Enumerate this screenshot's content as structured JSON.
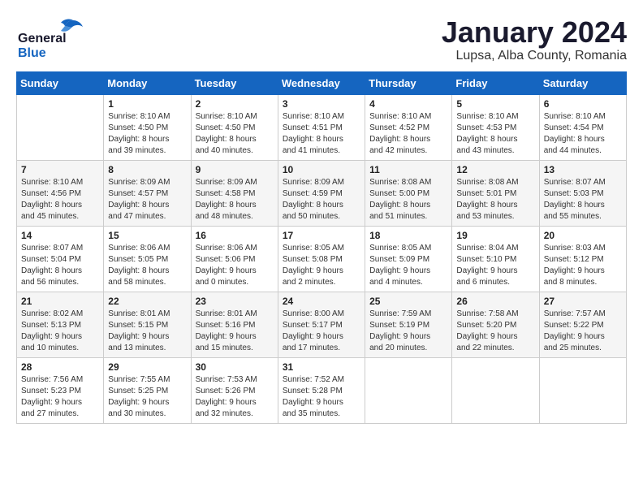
{
  "header": {
    "logo_line1": "General",
    "logo_line2": "Blue",
    "month_title": "January 2024",
    "location": "Lupsa, Alba County, Romania"
  },
  "days_of_week": [
    "Sunday",
    "Monday",
    "Tuesday",
    "Wednesday",
    "Thursday",
    "Friday",
    "Saturday"
  ],
  "weeks": [
    [
      {
        "day": "",
        "sunrise": "",
        "sunset": "",
        "daylight": ""
      },
      {
        "day": "1",
        "sunrise": "Sunrise: 8:10 AM",
        "sunset": "Sunset: 4:50 PM",
        "daylight": "Daylight: 8 hours and 39 minutes."
      },
      {
        "day": "2",
        "sunrise": "Sunrise: 8:10 AM",
        "sunset": "Sunset: 4:50 PM",
        "daylight": "Daylight: 8 hours and 40 minutes."
      },
      {
        "day": "3",
        "sunrise": "Sunrise: 8:10 AM",
        "sunset": "Sunset: 4:51 PM",
        "daylight": "Daylight: 8 hours and 41 minutes."
      },
      {
        "day": "4",
        "sunrise": "Sunrise: 8:10 AM",
        "sunset": "Sunset: 4:52 PM",
        "daylight": "Daylight: 8 hours and 42 minutes."
      },
      {
        "day": "5",
        "sunrise": "Sunrise: 8:10 AM",
        "sunset": "Sunset: 4:53 PM",
        "daylight": "Daylight: 8 hours and 43 minutes."
      },
      {
        "day": "6",
        "sunrise": "Sunrise: 8:10 AM",
        "sunset": "Sunset: 4:54 PM",
        "daylight": "Daylight: 8 hours and 44 minutes."
      }
    ],
    [
      {
        "day": "7",
        "sunrise": "Sunrise: 8:10 AM",
        "sunset": "Sunset: 4:56 PM",
        "daylight": "Daylight: 8 hours and 45 minutes."
      },
      {
        "day": "8",
        "sunrise": "Sunrise: 8:09 AM",
        "sunset": "Sunset: 4:57 PM",
        "daylight": "Daylight: 8 hours and 47 minutes."
      },
      {
        "day": "9",
        "sunrise": "Sunrise: 8:09 AM",
        "sunset": "Sunset: 4:58 PM",
        "daylight": "Daylight: 8 hours and 48 minutes."
      },
      {
        "day": "10",
        "sunrise": "Sunrise: 8:09 AM",
        "sunset": "Sunset: 4:59 PM",
        "daylight": "Daylight: 8 hours and 50 minutes."
      },
      {
        "day": "11",
        "sunrise": "Sunrise: 8:08 AM",
        "sunset": "Sunset: 5:00 PM",
        "daylight": "Daylight: 8 hours and 51 minutes."
      },
      {
        "day": "12",
        "sunrise": "Sunrise: 8:08 AM",
        "sunset": "Sunset: 5:01 PM",
        "daylight": "Daylight: 8 hours and 53 minutes."
      },
      {
        "day": "13",
        "sunrise": "Sunrise: 8:07 AM",
        "sunset": "Sunset: 5:03 PM",
        "daylight": "Daylight: 8 hours and 55 minutes."
      }
    ],
    [
      {
        "day": "14",
        "sunrise": "Sunrise: 8:07 AM",
        "sunset": "Sunset: 5:04 PM",
        "daylight": "Daylight: 8 hours and 56 minutes."
      },
      {
        "day": "15",
        "sunrise": "Sunrise: 8:06 AM",
        "sunset": "Sunset: 5:05 PM",
        "daylight": "Daylight: 8 hours and 58 minutes."
      },
      {
        "day": "16",
        "sunrise": "Sunrise: 8:06 AM",
        "sunset": "Sunset: 5:06 PM",
        "daylight": "Daylight: 9 hours and 0 minutes."
      },
      {
        "day": "17",
        "sunrise": "Sunrise: 8:05 AM",
        "sunset": "Sunset: 5:08 PM",
        "daylight": "Daylight: 9 hours and 2 minutes."
      },
      {
        "day": "18",
        "sunrise": "Sunrise: 8:05 AM",
        "sunset": "Sunset: 5:09 PM",
        "daylight": "Daylight: 9 hours and 4 minutes."
      },
      {
        "day": "19",
        "sunrise": "Sunrise: 8:04 AM",
        "sunset": "Sunset: 5:10 PM",
        "daylight": "Daylight: 9 hours and 6 minutes."
      },
      {
        "day": "20",
        "sunrise": "Sunrise: 8:03 AM",
        "sunset": "Sunset: 5:12 PM",
        "daylight": "Daylight: 9 hours and 8 minutes."
      }
    ],
    [
      {
        "day": "21",
        "sunrise": "Sunrise: 8:02 AM",
        "sunset": "Sunset: 5:13 PM",
        "daylight": "Daylight: 9 hours and 10 minutes."
      },
      {
        "day": "22",
        "sunrise": "Sunrise: 8:01 AM",
        "sunset": "Sunset: 5:15 PM",
        "daylight": "Daylight: 9 hours and 13 minutes."
      },
      {
        "day": "23",
        "sunrise": "Sunrise: 8:01 AM",
        "sunset": "Sunset: 5:16 PM",
        "daylight": "Daylight: 9 hours and 15 minutes."
      },
      {
        "day": "24",
        "sunrise": "Sunrise: 8:00 AM",
        "sunset": "Sunset: 5:17 PM",
        "daylight": "Daylight: 9 hours and 17 minutes."
      },
      {
        "day": "25",
        "sunrise": "Sunrise: 7:59 AM",
        "sunset": "Sunset: 5:19 PM",
        "daylight": "Daylight: 9 hours and 20 minutes."
      },
      {
        "day": "26",
        "sunrise": "Sunrise: 7:58 AM",
        "sunset": "Sunset: 5:20 PM",
        "daylight": "Daylight: 9 hours and 22 minutes."
      },
      {
        "day": "27",
        "sunrise": "Sunrise: 7:57 AM",
        "sunset": "Sunset: 5:22 PM",
        "daylight": "Daylight: 9 hours and 25 minutes."
      }
    ],
    [
      {
        "day": "28",
        "sunrise": "Sunrise: 7:56 AM",
        "sunset": "Sunset: 5:23 PM",
        "daylight": "Daylight: 9 hours and 27 minutes."
      },
      {
        "day": "29",
        "sunrise": "Sunrise: 7:55 AM",
        "sunset": "Sunset: 5:25 PM",
        "daylight": "Daylight: 9 hours and 30 minutes."
      },
      {
        "day": "30",
        "sunrise": "Sunrise: 7:53 AM",
        "sunset": "Sunset: 5:26 PM",
        "daylight": "Daylight: 9 hours and 32 minutes."
      },
      {
        "day": "31",
        "sunrise": "Sunrise: 7:52 AM",
        "sunset": "Sunset: 5:28 PM",
        "daylight": "Daylight: 9 hours and 35 minutes."
      },
      {
        "day": "",
        "sunrise": "",
        "sunset": "",
        "daylight": ""
      },
      {
        "day": "",
        "sunrise": "",
        "sunset": "",
        "daylight": ""
      },
      {
        "day": "",
        "sunrise": "",
        "sunset": "",
        "daylight": ""
      }
    ]
  ]
}
